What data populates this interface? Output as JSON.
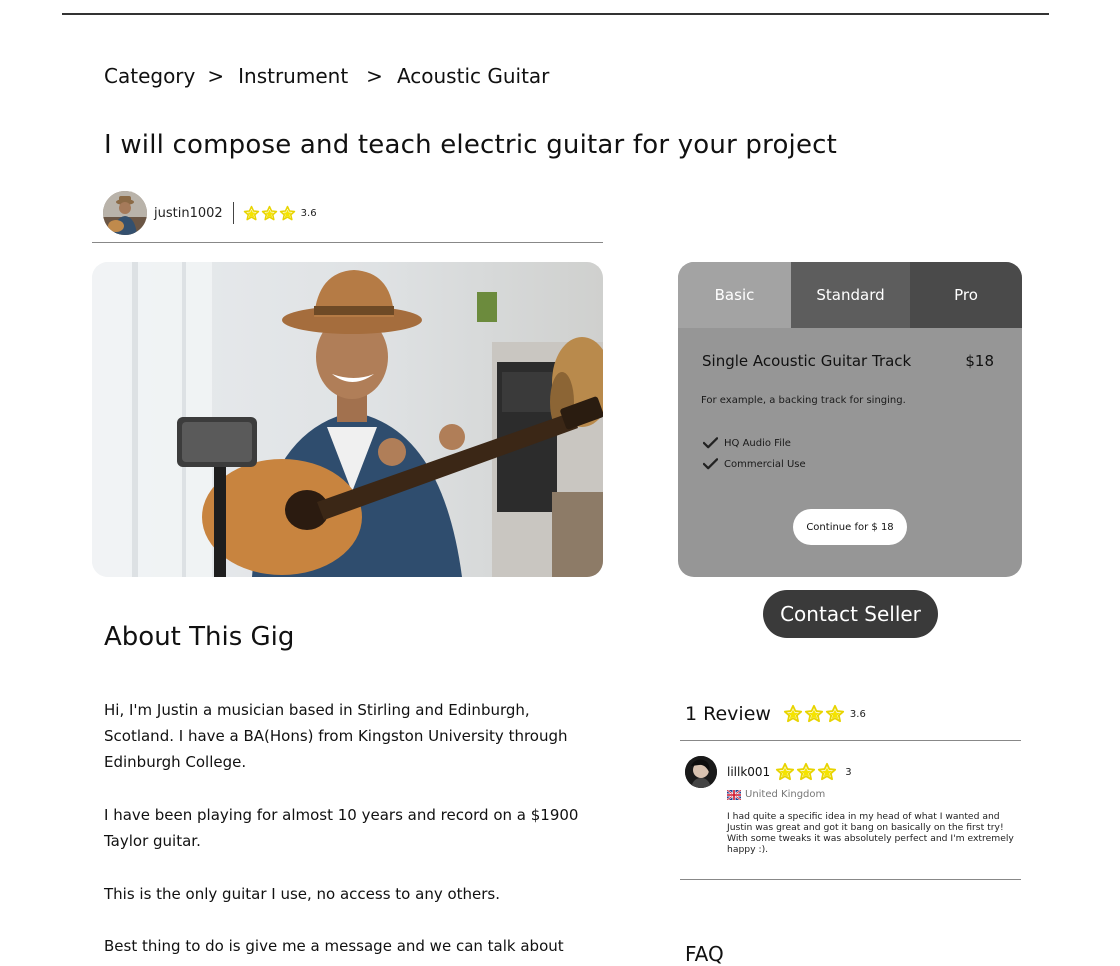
{
  "breadcrumb": {
    "items": [
      "Category",
      "Instrument",
      "Acoustic Guitar"
    ],
    "separator": ">"
  },
  "gig": {
    "title": "I will compose and teach electric guitar for your project"
  },
  "seller": {
    "username": "justin1002",
    "rating": "3.6",
    "stars_shown": 3
  },
  "packages": {
    "tabs": [
      "Basic",
      "Standard",
      "Pro"
    ],
    "selected": "Basic",
    "name": "Single Acoustic Guitar Track",
    "price": "$18",
    "description": "For example, a backing track for singing.",
    "features": [
      "HQ Audio File",
      "Commercial Use"
    ],
    "continue_label": "Continue for $ 18"
  },
  "contact_label": "Contact Seller",
  "about": {
    "heading": "About This Gig",
    "paragraphs": [
      "Hi, I'm Justin a musician based in Stirling and Edinburgh, Scotland. I have a BA(Hons) from Kingston University through Edinburgh College.",
      "I have been playing for almost 10 years and record on a $1900 Taylor guitar.",
      "This is the only guitar I use, no access to any others.",
      "Best thing to do is give me a message and we can talk about"
    ]
  },
  "reviews": {
    "heading": "1 Review",
    "rating": "3.6",
    "items": [
      {
        "user": "lillk001",
        "rating": "3",
        "country": "United Kingdom",
        "text": "I had quite a specific idea in my head of what I wanted and Justin was great and got it bang on basically on the first try! With some tweaks it was absolutely perfect and I'm extremely happy :)."
      }
    ]
  },
  "faq_heading": "FAQ",
  "colors": {
    "star": "#f5e400",
    "star_stroke": "#c9b800",
    "package_bg": "#969696",
    "tab_basic": "#a3a3a3",
    "tab_standard": "#5d5d5d",
    "tab_pro": "#4a4a4a",
    "contact_bg": "#3a3a3a"
  },
  "icons": {
    "star": "star-icon",
    "check": "check-icon",
    "flag": "uk-flag-icon"
  }
}
